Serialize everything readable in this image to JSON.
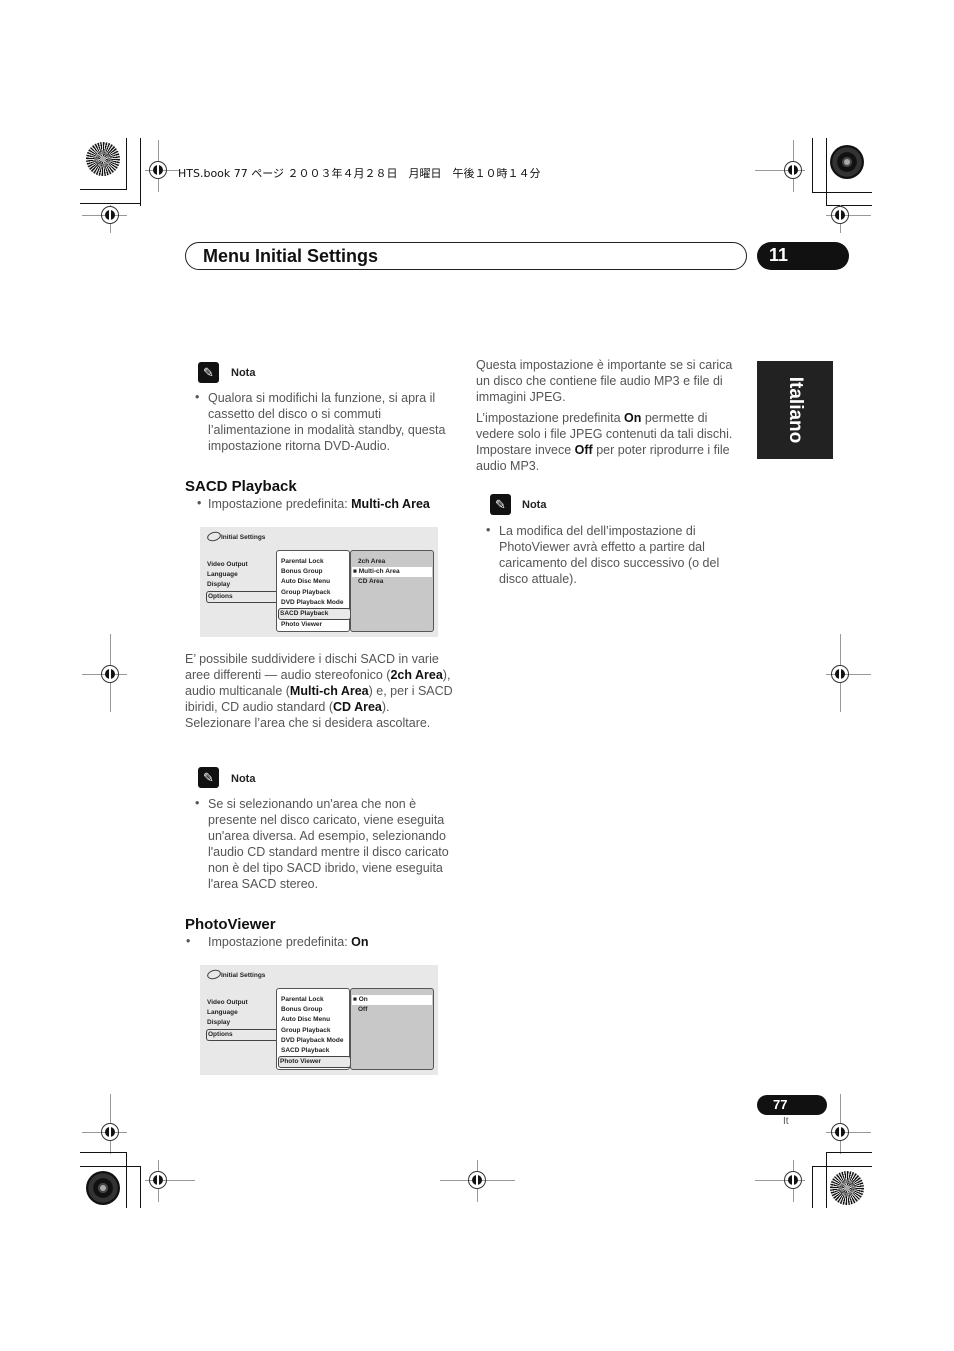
{
  "print_header": "HTS.book  77 ページ  ２００３年４月２８日　月曜日　午後１０時１４分",
  "section_title": "Menu Initial Settings",
  "chapter_number": "11",
  "language_tab": "Italiano",
  "page": {
    "number": "77",
    "lang_code": "It"
  },
  "notes": [
    {
      "label": "Nota",
      "text": "Qualora si modifichi la funzione, si apra il cassetto del disco o si commuti l’alimentazione in modalità standby, questa impostazione ritorna DVD-Audio."
    },
    {
      "label": "Nota",
      "text": "Se si selezionando un'area che non è presente nel disco caricato, viene eseguita un'area diversa. Ad esempio, selezionando l'audio CD standard mentre il disco caricato non è del tipo SACD ibrido, viene eseguita l'area SACD stereo."
    },
    {
      "label": "Nota",
      "text": "La modifica del dell’impostazione di PhotoViewer avrà effetto a partire dal caricamento del disco successivo (o del disco attuale)."
    }
  ],
  "sacd": {
    "heading": "SACD Playback",
    "default_prefix": "Impostazione predefinita: ",
    "default_value": "Multi-ch Area",
    "paragraph": {
      "p1": "E’ possibile suddividere i dischi SACD in varie aree differenti — audio stereofonico (",
      "b1": "2ch Area",
      "p2": "), audio multicanale (",
      "b2": "Multi-ch Area",
      "p3": ") e, per i SACD ibiridi, CD audio standard (",
      "b3": "CD Area",
      "p4": "). Selezionare l’area che si desidera ascoltare."
    }
  },
  "photoviewer": {
    "heading": "PhotoViewer",
    "default_prefix": "Impostazione predefinita: ",
    "default_value": "On"
  },
  "right_column": {
    "para1": "Questa impostazione è importante se si carica un disco che contiene file audio MP3 e file di immagini JPEG.",
    "para2_a": "L’impostazione predefinita ",
    "para2_b1": "On",
    "para2_c": " permette di vedere solo i file JPEG contenuti da tali dischi. Impostare invece ",
    "para2_b2": "Off",
    "para2_d": " per poter riprodurre i file audio MP3."
  },
  "osd_common": {
    "title": "Initial Settings",
    "col1": [
      "Video Output",
      "Language",
      "Display",
      "Options"
    ],
    "col2": [
      "Parental  Lock",
      "Bonus Group",
      "Auto Disc Menu",
      "Group Playback",
      "DVD Playback Mode",
      "SACD Playback",
      "Photo Viewer"
    ]
  },
  "osd_sacd": {
    "options": [
      "2ch Area",
      "■ Multi-ch Area",
      "CD Area"
    ],
    "selected_col2": "SACD Playback",
    "selected_option": "Multi-ch Area"
  },
  "osd_photo": {
    "options": [
      "■ On",
      "Off"
    ],
    "selected_col2": "Photo Viewer",
    "selected_option": "On"
  }
}
